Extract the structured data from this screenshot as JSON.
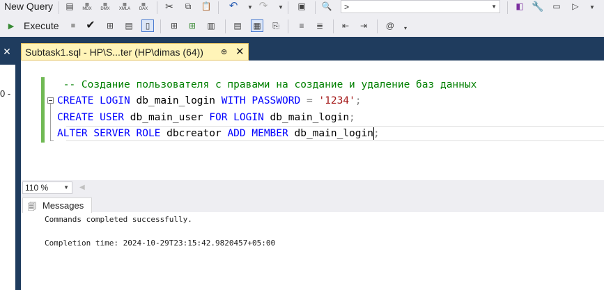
{
  "toolbar1": {
    "new_query_label": "New Query",
    "icons": [
      "mdx-icon",
      "dmx-icon",
      "xmla-icon",
      "dax-icon"
    ],
    "mdx_label": "MDX",
    "dmx_label": "DMX",
    "xmla_label": "XMLA",
    "dax_label": "DAX",
    "query_dropdown_value": ">"
  },
  "toolbar2": {
    "execute_label": "Execute"
  },
  "tab": {
    "title": "Subtask1.sql - HP\\S...ter (HP\\dimas (64))",
    "pin": "⊕",
    "close": "✕"
  },
  "editor": {
    "lines": [
      {
        "parts": [
          {
            "t": "cm",
            "v": "-- Создание пользователя с правами на создание и удаление баз данных"
          }
        ]
      },
      {
        "parts": [
          {
            "t": "kw",
            "v": "CREATE LOGIN"
          },
          {
            "t": "id",
            "v": " db_main_login "
          },
          {
            "t": "kw",
            "v": "WITH PASSWORD"
          },
          {
            "t": "op",
            "v": " = "
          },
          {
            "t": "st",
            "v": "'1234'"
          },
          {
            "t": "op",
            "v": ";"
          }
        ]
      },
      {
        "parts": [
          {
            "t": "kw",
            "v": "CREATE USER"
          },
          {
            "t": "id",
            "v": " db_main_user "
          },
          {
            "t": "kw",
            "v": "FOR LOGIN"
          },
          {
            "t": "id",
            "v": " db_main_login"
          },
          {
            "t": "op",
            "v": ";"
          }
        ]
      },
      {
        "parts": [
          {
            "t": "kw",
            "v": "ALTER SERVER ROLE"
          },
          {
            "t": "id",
            "v": " dbcreator "
          },
          {
            "t": "kw",
            "v": "ADD MEMBER"
          },
          {
            "t": "id",
            "v": " db_main_login"
          },
          {
            "t": "op",
            "v": ";"
          }
        ]
      }
    ]
  },
  "zoom": {
    "value": "110 %"
  },
  "results": {
    "tab_label": "Messages",
    "lines": [
      "Commands completed successfully.",
      "",
      "Completion time: 2024-10-29T23:15:42.9820457+05:00"
    ]
  },
  "left_strip": {
    "number": "0 -"
  }
}
